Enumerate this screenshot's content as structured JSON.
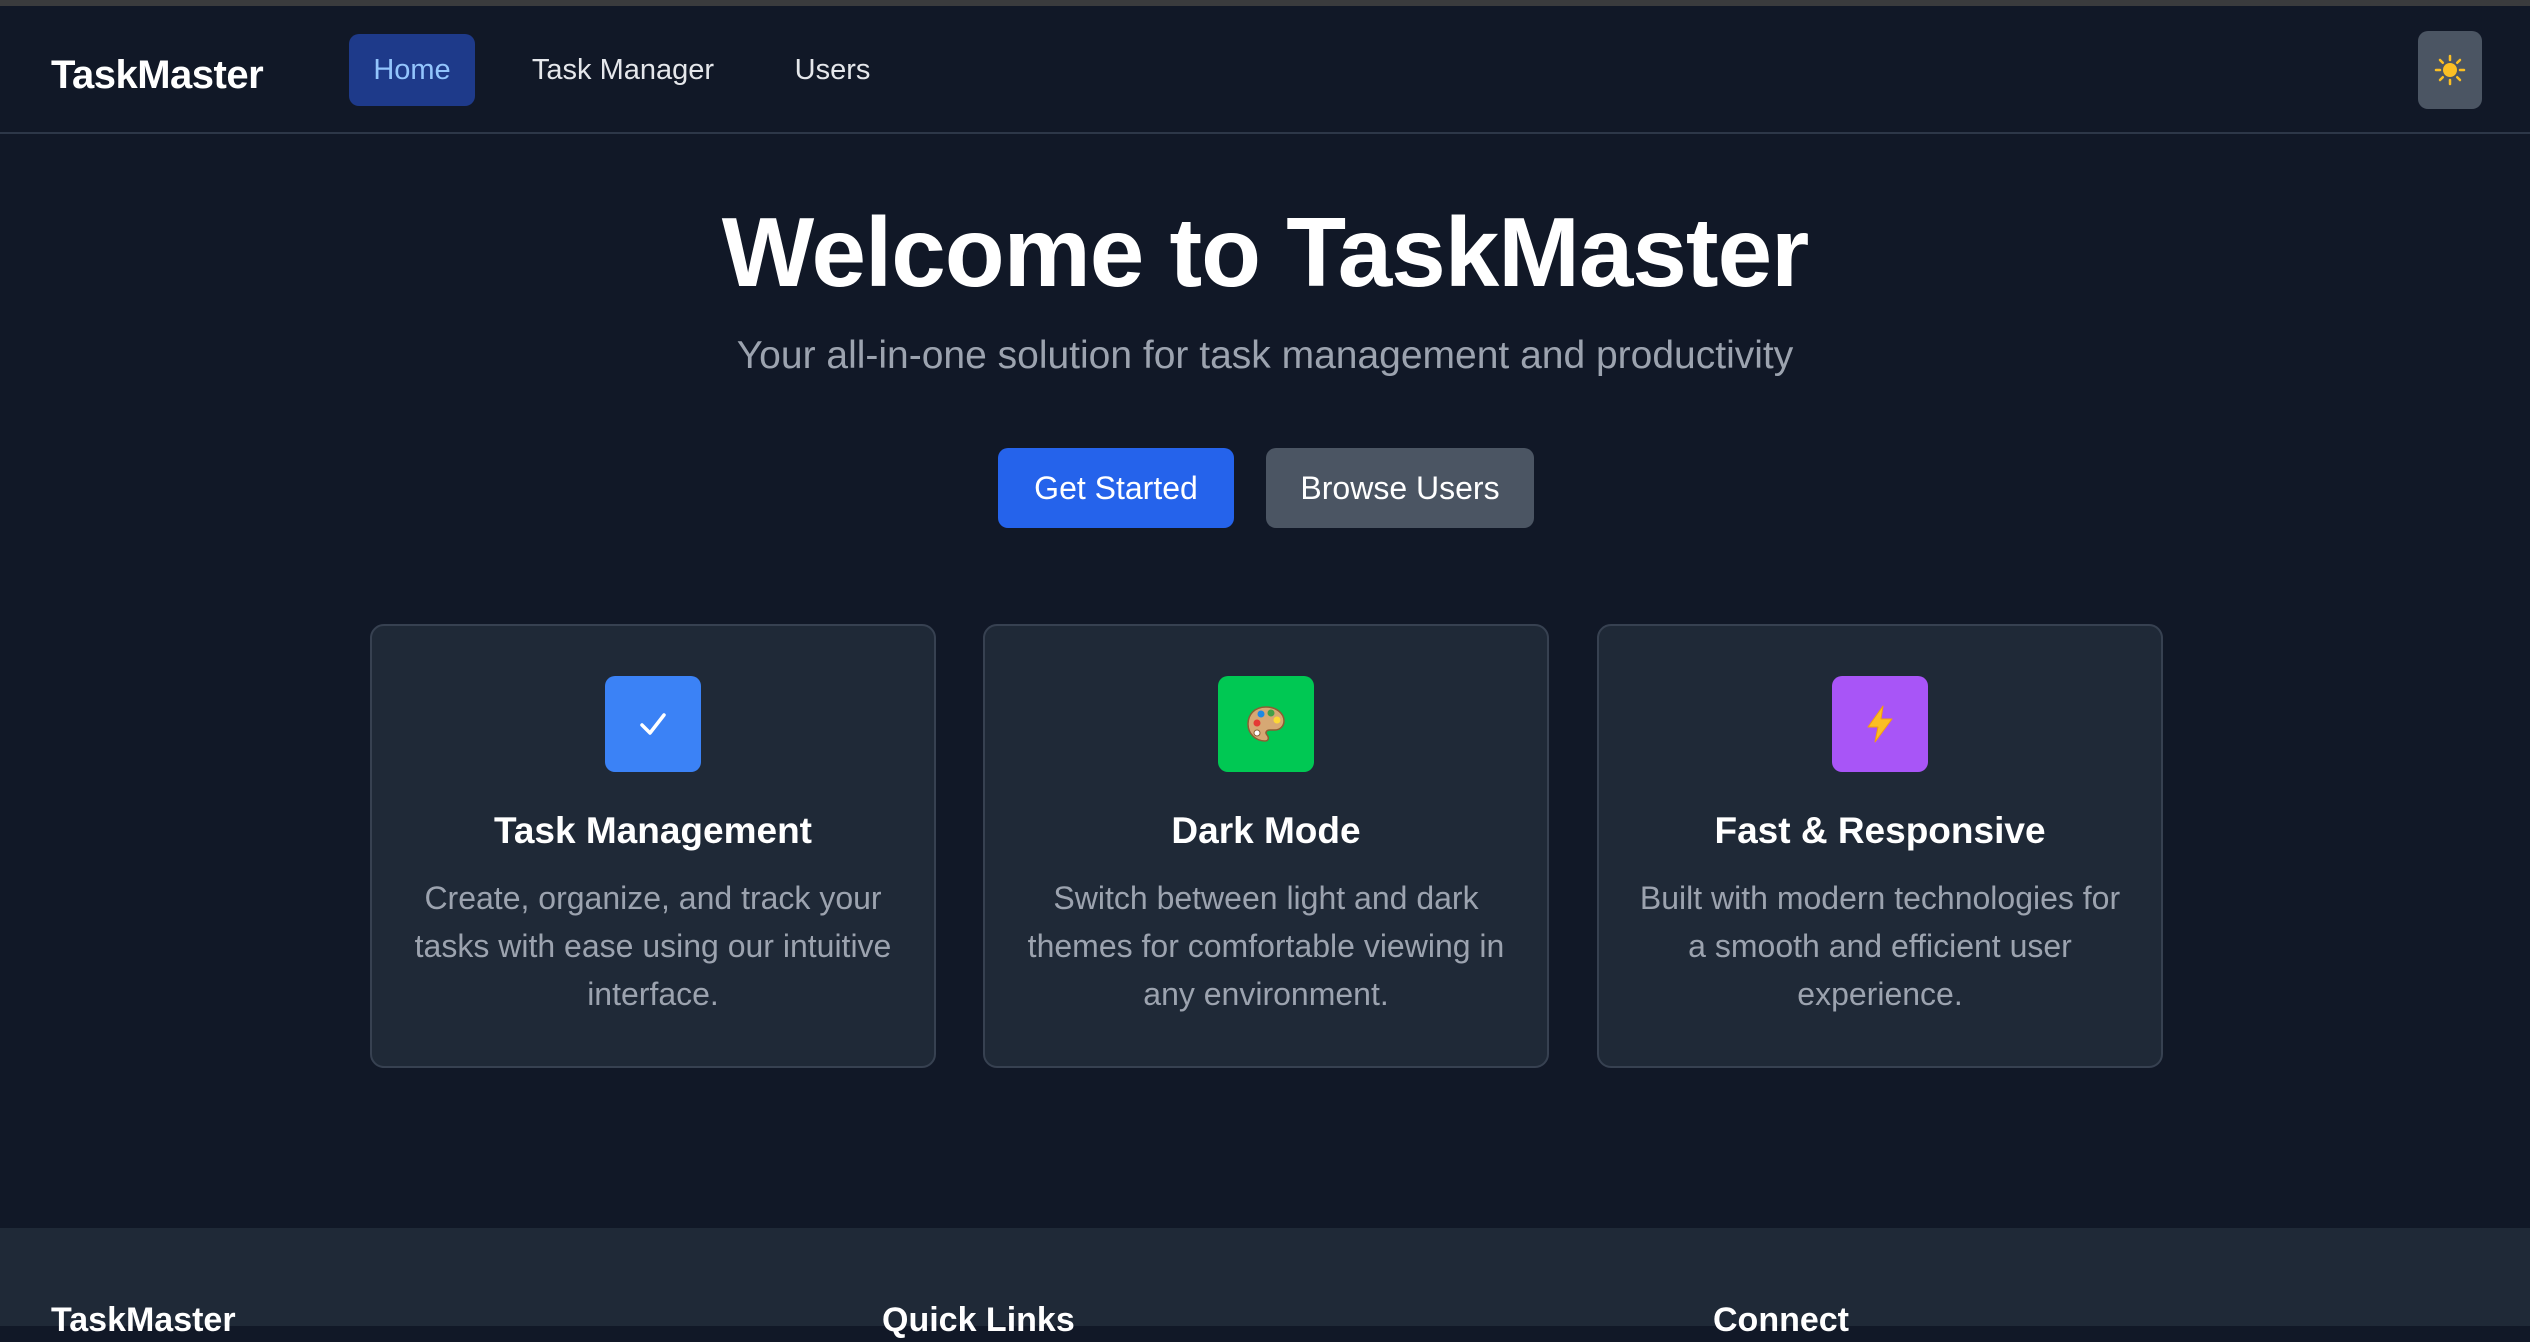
{
  "navbar": {
    "brand": "TaskMaster",
    "links": [
      {
        "label": "Home",
        "active": true
      },
      {
        "label": "Task Manager",
        "active": false
      },
      {
        "label": "Users",
        "active": false
      }
    ],
    "theme_toggle_icon": "sun-icon"
  },
  "hero": {
    "title": "Welcome to TaskMaster",
    "subtitle": "Your all-in-one solution for task management and productivity",
    "primary_button": "Get Started",
    "secondary_button": "Browse Users"
  },
  "features": [
    {
      "icon": "checkmark-icon",
      "icon_color": "#3b82f6",
      "title": "Task Management",
      "description": "Create, organize, and track your tasks with ease using our intuitive interface."
    },
    {
      "icon": "palette-icon",
      "icon_color": "#00c853",
      "title": "Dark Mode",
      "description": "Switch between light and dark themes for comfortable viewing in any environment."
    },
    {
      "icon": "lightning-icon",
      "icon_color": "#a855f7",
      "title": "Fast & Responsive",
      "description": "Built with modern technologies for a smooth and efficient user experience."
    }
  ],
  "footer": {
    "headings": [
      "TaskMaster",
      "Quick Links",
      "Connect"
    ]
  },
  "colors": {
    "background": "#111827",
    "card": "#1f2937",
    "primary": "#2563eb",
    "secondary": "#4b5563"
  }
}
